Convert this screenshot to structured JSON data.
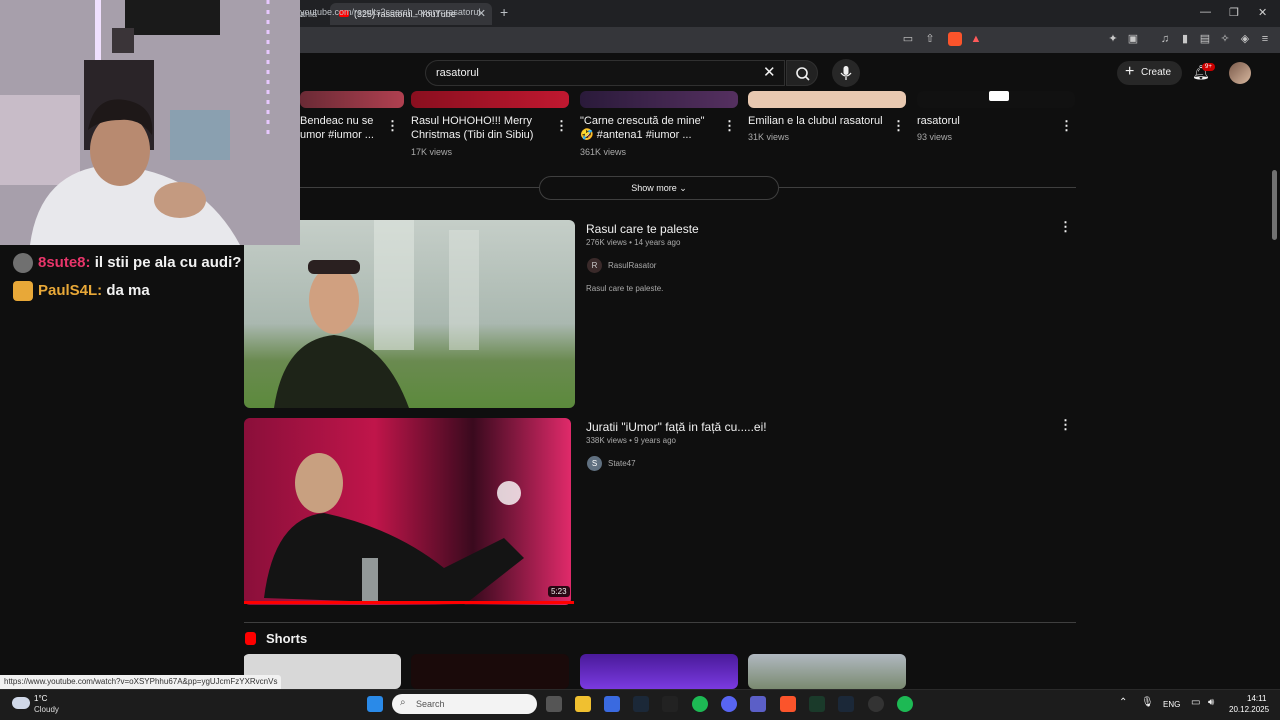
{
  "browser": {
    "inactive_tab_label": "ania'",
    "active_tab_label": "(325) rasatorul - YouTube",
    "new_tab": "+",
    "close_tab": "✕",
    "url": "youtube.com/results?search_query=rasatorul"
  },
  "youtube": {
    "search_query": "rasatorul",
    "create_label": "Create",
    "notif_count": "9+",
    "top_row": [
      {
        "title": "Bendeac nu se umor #iumor ...",
        "views": ""
      },
      {
        "title": "Rasul HOHOHO!!! Merry Christmas (Tibi din Sibiu)",
        "views": "17K views"
      },
      {
        "title": "\"Carne crescută de mine\" 🤣 #antena1 #iumor ...",
        "views": "361K views"
      },
      {
        "title": "Emilian e la clubul rasatorul",
        "views": "31K views"
      },
      {
        "title": "rasatorul",
        "views": "93 views"
      }
    ],
    "show_more": "Show more",
    "results": [
      {
        "title": "Rasul care te paleste",
        "meta": "276K views • 14 years ago",
        "channel": "RasulRasator",
        "channel_initial": "R",
        "description": "Rasul care te paleste."
      },
      {
        "title": "Juratii \"iUmor\" față in față cu.....ei!",
        "meta": "338K views • 9 years ago",
        "channel": "State47",
        "channel_initial": "S",
        "duration": "5:23"
      }
    ],
    "shorts_title": "Shorts"
  },
  "chat": [
    {
      "user": "8sute8:",
      "message": "il stii pe ala cu audi?",
      "color": "#e8356a"
    },
    {
      "user": "PaulS4L:",
      "message": "da ma",
      "color": "#e8a838"
    }
  ],
  "status_url": "https://www.youtube.com/watch?v=oXSYPhhu67A&pp=ygUJcmFzYXRvcnVs",
  "taskbar": {
    "temp": "1°C",
    "weather": "Cloudy",
    "search_placeholder": "Search",
    "lang": "ENG",
    "time": "14:11",
    "date": "20.12.2025"
  },
  "colors": {
    "accent": "#ff0000",
    "bg": "#0f0f0f"
  }
}
